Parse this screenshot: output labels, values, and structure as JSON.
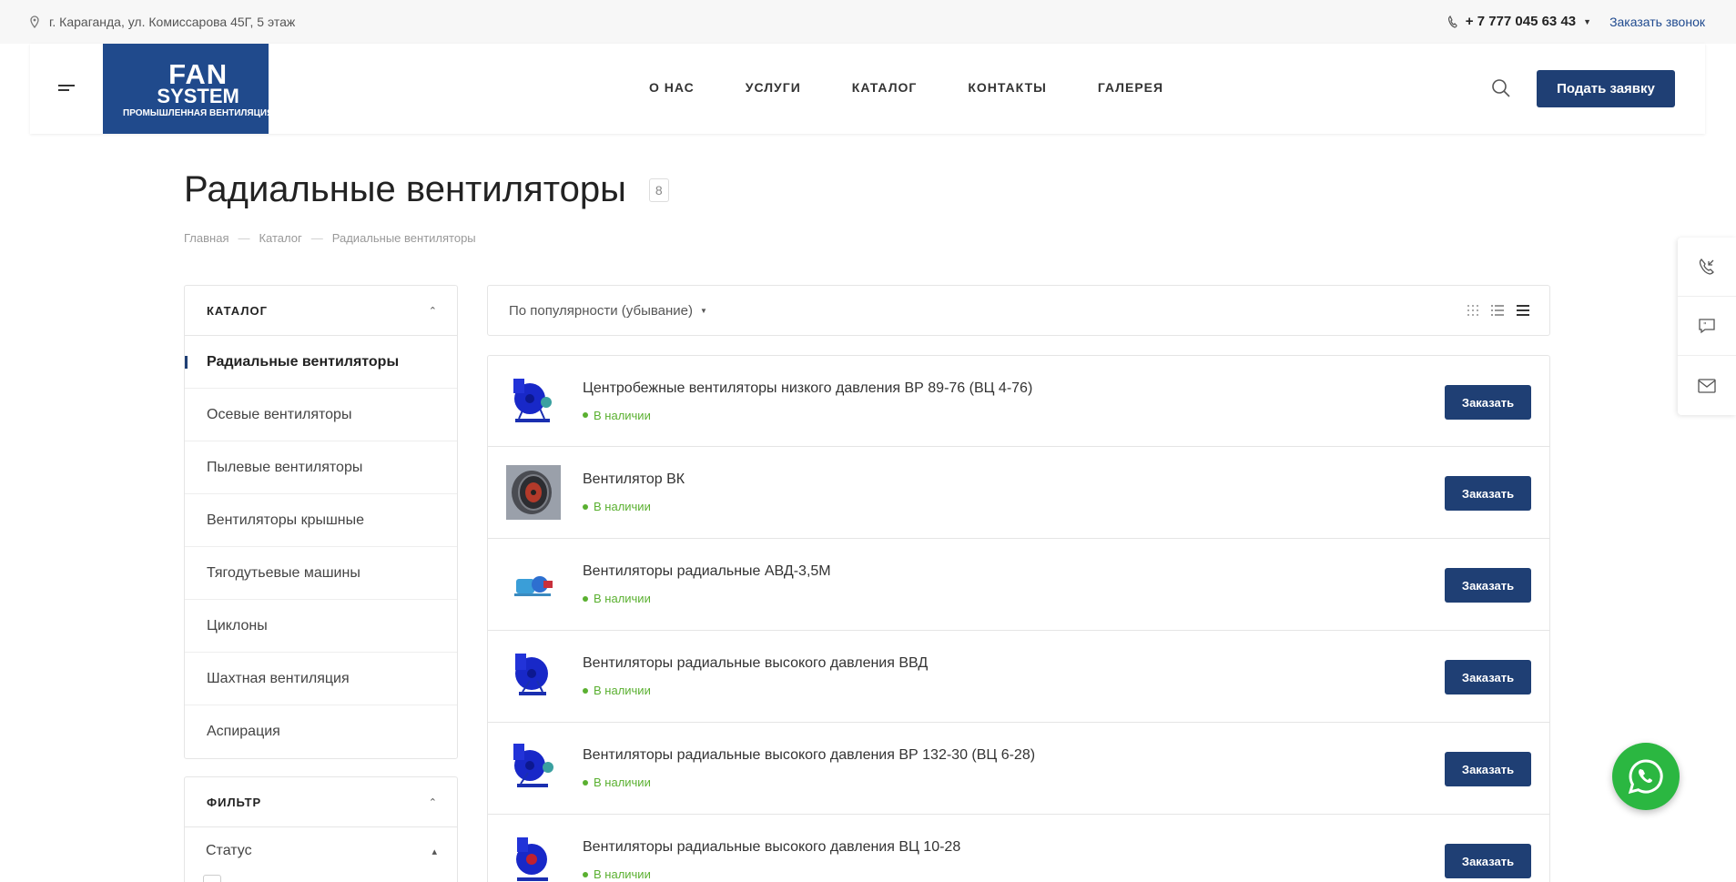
{
  "topbar": {
    "address": "г. Караганда, ул. Комиссарова 45Г, 5 этаж",
    "phone": "+ 7 777 045 63 43",
    "callback": "Заказать звонок"
  },
  "header": {
    "logo": {
      "line1": "FAN",
      "line2": "SYSTEM",
      "line3": "ПРОМЫШЛЕННАЯ ВЕНТИЛЯЦИЯ"
    },
    "nav": [
      "О НАС",
      "УСЛУГИ",
      "КАТАЛОГ",
      "КОНТАКТЫ",
      "ГАЛЕРЕЯ"
    ],
    "apply_label": "Подать заявку"
  },
  "page": {
    "title": "Радиальные вентиляторы",
    "count": "8",
    "breadcrumb": [
      "Главная",
      "Каталог",
      "Радиальные вентиляторы"
    ]
  },
  "sidebar": {
    "title": "КАТАЛОГ",
    "items": [
      "Радиальные вентиляторы",
      "Осевые вентиляторы",
      "Пылевые вентиляторы",
      "Вентиляторы крышные",
      "Тягодутьевые машины",
      "Циклоны",
      "Шахтная вентиляция",
      "Аспирация"
    ],
    "active_index": 0
  },
  "filter": {
    "title": "ФИЛЬТР",
    "status_label": "Статус"
  },
  "sort": {
    "label": "По популярности (убывание)"
  },
  "products": [
    {
      "name": "Центробежные вентиляторы низкого давления ВР 89-76 (ВЦ 4-76)",
      "stock": "В наличии",
      "order": "Заказать",
      "thumb": "blue-fan"
    },
    {
      "name": "Вентилятор ВК",
      "stock": "В наличии",
      "order": "Заказать",
      "thumb": "duct-fan"
    },
    {
      "name": "Вентиляторы радиальные АВД-3,5М",
      "stock": "В наличии",
      "order": "Заказать",
      "thumb": "small-fan"
    },
    {
      "name": "Вентиляторы радиальные высокого давления ВВД",
      "stock": "В наличии",
      "order": "Заказать",
      "thumb": "blue-fan"
    },
    {
      "name": "Вентиляторы радиальные высокого давления ВР 132-30 (ВЦ 6-28)",
      "stock": "В наличии",
      "order": "Заказать",
      "thumb": "blue-fan"
    },
    {
      "name": "Вентиляторы радиальные высокого давления ВЦ 10-28",
      "stock": "В наличии",
      "order": "Заказать",
      "thumb": "blue-fan"
    }
  ],
  "colors": {
    "brand": "#1f3f74",
    "logo_bg": "#204a8c",
    "in_stock": "#5ab030",
    "whatsapp": "#2bb741"
  }
}
